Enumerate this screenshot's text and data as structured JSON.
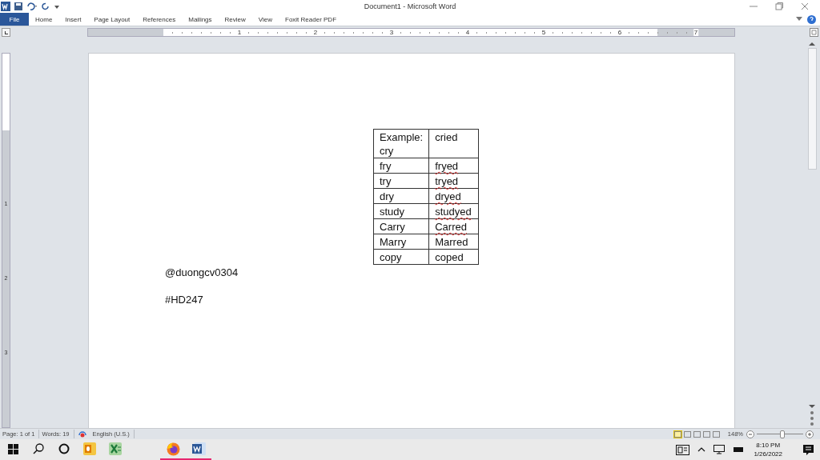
{
  "window": {
    "title": "Document1 - Microsoft Word"
  },
  "ribbon_tabs": [
    {
      "label": "File",
      "kind": "file"
    },
    {
      "label": "Home",
      "kind": "tab"
    },
    {
      "label": "Insert",
      "kind": "tab"
    },
    {
      "label": "Page Layout",
      "kind": "tab"
    },
    {
      "label": "References",
      "kind": "tab"
    },
    {
      "label": "Mailings",
      "kind": "tab"
    },
    {
      "label": "Review",
      "kind": "tab"
    },
    {
      "label": "View",
      "kind": "tab"
    },
    {
      "label": "Foxit Reader PDF",
      "kind": "tab"
    }
  ],
  "ruler": {
    "numbers": [
      "1",
      "2",
      "3",
      "4",
      "5",
      "6",
      "7"
    ]
  },
  "vertical_ruler": {
    "numbers": [
      "1",
      "2",
      "3"
    ]
  },
  "document": {
    "table": {
      "rows": [
        {
          "cells": [
            {
              "text": "Example: cry",
              "misspelled": false
            },
            {
              "text": "cried",
              "misspelled": false
            }
          ]
        },
        {
          "cells": [
            {
              "text": "fry",
              "misspelled": false
            },
            {
              "text": "fryed",
              "misspelled": true
            }
          ]
        },
        {
          "cells": [
            {
              "text": "try",
              "misspelled": false
            },
            {
              "text": "tryed",
              "misspelled": true
            }
          ]
        },
        {
          "cells": [
            {
              "text": "dry",
              "misspelled": false
            },
            {
              "text": "dryed",
              "misspelled": true
            }
          ]
        },
        {
          "cells": [
            {
              "text": "study",
              "misspelled": false
            },
            {
              "text": "studyed",
              "misspelled": true
            }
          ]
        },
        {
          "cells": [
            {
              "text": "Carry",
              "misspelled": false
            },
            {
              "text": "Carred",
              "misspelled": true
            }
          ]
        },
        {
          "cells": [
            {
              "text": "Marry",
              "misspelled": false
            },
            {
              "text": "Marred",
              "misspelled": false
            }
          ]
        },
        {
          "cells": [
            {
              "text": "copy",
              "misspelled": false
            },
            {
              "text": "coped",
              "misspelled": false
            }
          ]
        }
      ]
    },
    "paragraphs": [
      "@duongcv0304",
      "#HD247"
    ]
  },
  "status_bar": {
    "page": "Page: 1 of 1",
    "words": "Words: 19",
    "language": "English (U.S.)",
    "views": [
      {
        "selected": true
      },
      {
        "selected": false
      },
      {
        "selected": false
      },
      {
        "selected": false
      },
      {
        "selected": false
      }
    ],
    "zoom": "148%",
    "zoom_slider": {
      "level": 0.55
    }
  },
  "taskbar": {
    "apps": [
      {
        "kind": "start",
        "running": false
      },
      {
        "kind": "search",
        "running": false
      },
      {
        "kind": "cortana",
        "running": false
      },
      {
        "kind": "outlook",
        "running": false
      },
      {
        "kind": "excel",
        "running": false
      },
      {
        "kind": "firefox",
        "running": true
      },
      {
        "kind": "word",
        "running": true
      }
    ],
    "time": "8:10 PM",
    "date": "1/26/2022"
  }
}
